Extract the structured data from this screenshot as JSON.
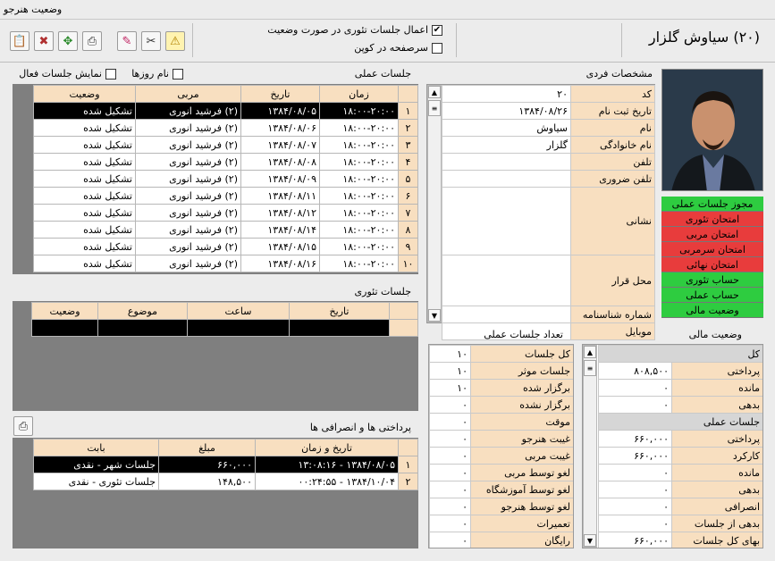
{
  "window": {
    "title": "وضعیت هنرجو"
  },
  "header": {
    "person_name": "(۲۰) سیاوش گلزار",
    "apply_theory_label": "اعمال جلسات تئوری در صورت وضعیت",
    "apply_theory_checked": true,
    "coupon_label": "سرصفحه در کوپن",
    "coupon_checked": false
  },
  "personal": {
    "title": "مشخصات فردی",
    "fields": [
      {
        "label": "کد",
        "value": "۲۰"
      },
      {
        "label": "تاریخ ثبت نام",
        "value": "۱۳۸۴/۰۸/۲۶"
      },
      {
        "label": "نام",
        "value": "سیاوش"
      },
      {
        "label": "نام خانوادگی",
        "value": "گلزار"
      },
      {
        "label": "تلفن",
        "value": ""
      },
      {
        "label": "تلفن ضروری",
        "value": ""
      },
      {
        "label": "نشانی",
        "value": ""
      },
      {
        "label": "محل قرار",
        "value": ""
      },
      {
        "label": "شماره شناسنامه",
        "value": ""
      },
      {
        "label": "موبایل",
        "value": ""
      }
    ]
  },
  "permissions": [
    {
      "label": "مجوز جلسات عملی",
      "color": "#2ecc40"
    },
    {
      "label": "امتحان تئوری",
      "color": "#e83c3c"
    },
    {
      "label": "امتحان مربی",
      "color": "#e83c3c"
    },
    {
      "label": "امتحان سرمربی",
      "color": "#e83c3c"
    },
    {
      "label": "امتحان نهائی",
      "color": "#e83c3c"
    },
    {
      "label": "حساب تئوری",
      "color": "#2ecc40"
    },
    {
      "label": "حساب عملی",
      "color": "#2ecc40"
    },
    {
      "label": "وضعیت مالی",
      "color": "#2ecc40"
    }
  ],
  "practical": {
    "title": "جلسات عملی",
    "show_days_label": "نام روزها",
    "show_active_label": "نمایش جلسات فعال",
    "columns": [
      "زمان",
      "تاریخ",
      "مربی",
      "وضعیت"
    ],
    "rows": [
      {
        "n": "۱",
        "time": "۱۸:۰۰-۲۰:۰۰",
        "date": "۱۳۸۴/۰۸/۰۵",
        "coach": "(۲) فرشید انوری",
        "status": "تشکیل شده"
      },
      {
        "n": "۲",
        "time": "۱۸:۰۰-۲۰:۰۰",
        "date": "۱۳۸۴/۰۸/۰۶",
        "coach": "(۲) فرشید انوری",
        "status": "تشکیل شده"
      },
      {
        "n": "۳",
        "time": "۱۸:۰۰-۲۰:۰۰",
        "date": "۱۳۸۴/۰۸/۰۷",
        "coach": "(۲) فرشید انوری",
        "status": "تشکیل شده"
      },
      {
        "n": "۴",
        "time": "۱۸:۰۰-۲۰:۰۰",
        "date": "۱۳۸۴/۰۸/۰۸",
        "coach": "(۲) فرشید انوری",
        "status": "تشکیل شده"
      },
      {
        "n": "۵",
        "time": "۱۸:۰۰-۲۰:۰۰",
        "date": "۱۳۸۴/۰۸/۰۹",
        "coach": "(۲) فرشید انوری",
        "status": "تشکیل شده"
      },
      {
        "n": "۶",
        "time": "۱۸:۰۰-۲۰:۰۰",
        "date": "۱۳۸۴/۰۸/۱۱",
        "coach": "(۲) فرشید انوری",
        "status": "تشکیل شده"
      },
      {
        "n": "۷",
        "time": "۱۸:۰۰-۲۰:۰۰",
        "date": "۱۳۸۴/۰۸/۱۲",
        "coach": "(۲) فرشید انوری",
        "status": "تشکیل شده"
      },
      {
        "n": "۸",
        "time": "۱۸:۰۰-۲۰:۰۰",
        "date": "۱۳۸۴/۰۸/۱۴",
        "coach": "(۲) فرشید انوری",
        "status": "تشکیل شده"
      },
      {
        "n": "۹",
        "time": "۱۸:۰۰-۲۰:۰۰",
        "date": "۱۳۸۴/۰۸/۱۵",
        "coach": "(۲) فرشید انوری",
        "status": "تشکیل شده"
      },
      {
        "n": "۱۰",
        "time": "۱۸:۰۰-۲۰:۰۰",
        "date": "۱۳۸۴/۰۸/۱۶",
        "coach": "(۲) فرشید انوری",
        "status": "تشکیل شده"
      }
    ]
  },
  "theory": {
    "title": "جلسات تئوری",
    "columns": [
      "تاریخ",
      "ساعت",
      "موضوع",
      "وضعیت"
    ]
  },
  "payments": {
    "title": "پرداختی ها و انصرافی ها",
    "columns": [
      "تاریخ و زمان",
      "مبلغ",
      "بابت"
    ],
    "rows": [
      {
        "n": "۱",
        "datetime": "۱۳۸۴/۰۸/۰۵ - ۱۳:۰۸:۱۶",
        "amount": "۶۶۰,۰۰۰",
        "for": "جلسات شهر - نقدی"
      },
      {
        "n": "۲",
        "datetime": "۱۳۸۴/۱۰/۰۴ - ۰۰:۲۴:۵۵",
        "amount": "۱۴۸,۵۰۰",
        "for": "جلسات تئوری - نقدی"
      }
    ]
  },
  "session_counts": {
    "title": "تعداد جلسات عملی",
    "rows": [
      {
        "label": "کل جلسات",
        "value": "۱۰"
      },
      {
        "label": "جلسات موثر",
        "value": "۱۰"
      },
      {
        "label": "برگزار شده",
        "value": "۱۰"
      },
      {
        "label": "برگزار نشده",
        "value": "۰"
      },
      {
        "label": "موقت",
        "value": "۰"
      },
      {
        "label": "غیبت هنرجو",
        "value": "۰"
      },
      {
        "label": "غیبت مربی",
        "value": "۰"
      },
      {
        "label": "لغو توسط مربی",
        "value": "۰"
      },
      {
        "label": "لغو توسط آموزشگاه",
        "value": "۰"
      },
      {
        "label": "لغو توسط هنرجو",
        "value": "۰"
      },
      {
        "label": "تعمیرات",
        "value": "۰"
      },
      {
        "label": "رایگان",
        "value": "۰"
      }
    ]
  },
  "financial": {
    "title": "وضعیت مالی",
    "total_header": "کل",
    "total_rows": [
      {
        "label": "پرداختی",
        "value": "۸۰۸,۵۰۰"
      },
      {
        "label": "مانده",
        "value": "۰"
      },
      {
        "label": "بدهی",
        "value": "۰"
      }
    ],
    "practical_header": "جلسات عملی",
    "practical_rows": [
      {
        "label": "پرداختی",
        "value": "۶۶۰,۰۰۰"
      },
      {
        "label": "کارکرد",
        "value": "۶۶۰,۰۰۰"
      },
      {
        "label": "مانده",
        "value": "۰"
      },
      {
        "label": "بدهی",
        "value": "۰"
      },
      {
        "label": "انصرافی",
        "value": "۰"
      },
      {
        "label": "بدهی از جلسات",
        "value": "۰"
      },
      {
        "label": "بهای کل جلسات",
        "value": "۶۶۰,۰۰۰"
      }
    ]
  }
}
